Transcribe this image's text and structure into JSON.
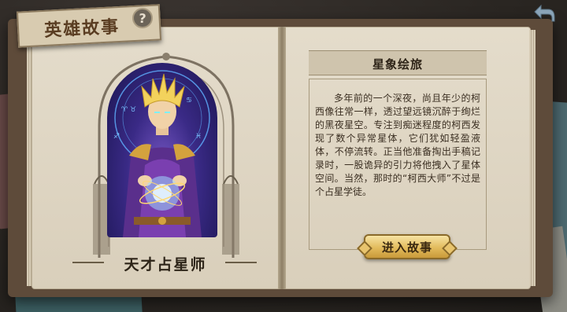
{
  "header": {
    "title": "英雄故事",
    "help_label": "?"
  },
  "hero": {
    "name": "天才占星师"
  },
  "story": {
    "chapter_title": "星象绘旅",
    "text": "多年前的一个深夜，尚且年少的柯西像往常一样，透过望远镜沉醉于绚烂的黑夜星空。专注到痴迷程度的柯西发现了数个异常星体，它们犹如轻盈液体，不停流转。正当他准备掏出手稿记录时，一股诡异的引力将他拽入了星体空间。当然，那时的“柯西大师”不过是个占星学徒。",
    "enter_button": "进入故事"
  },
  "icons": {
    "back": "back-arrow-icon",
    "help": "question-icon"
  },
  "colors": {
    "page": "#e4dccb",
    "button_gold": "#e2bb5c",
    "text_dark": "#2e2418"
  }
}
